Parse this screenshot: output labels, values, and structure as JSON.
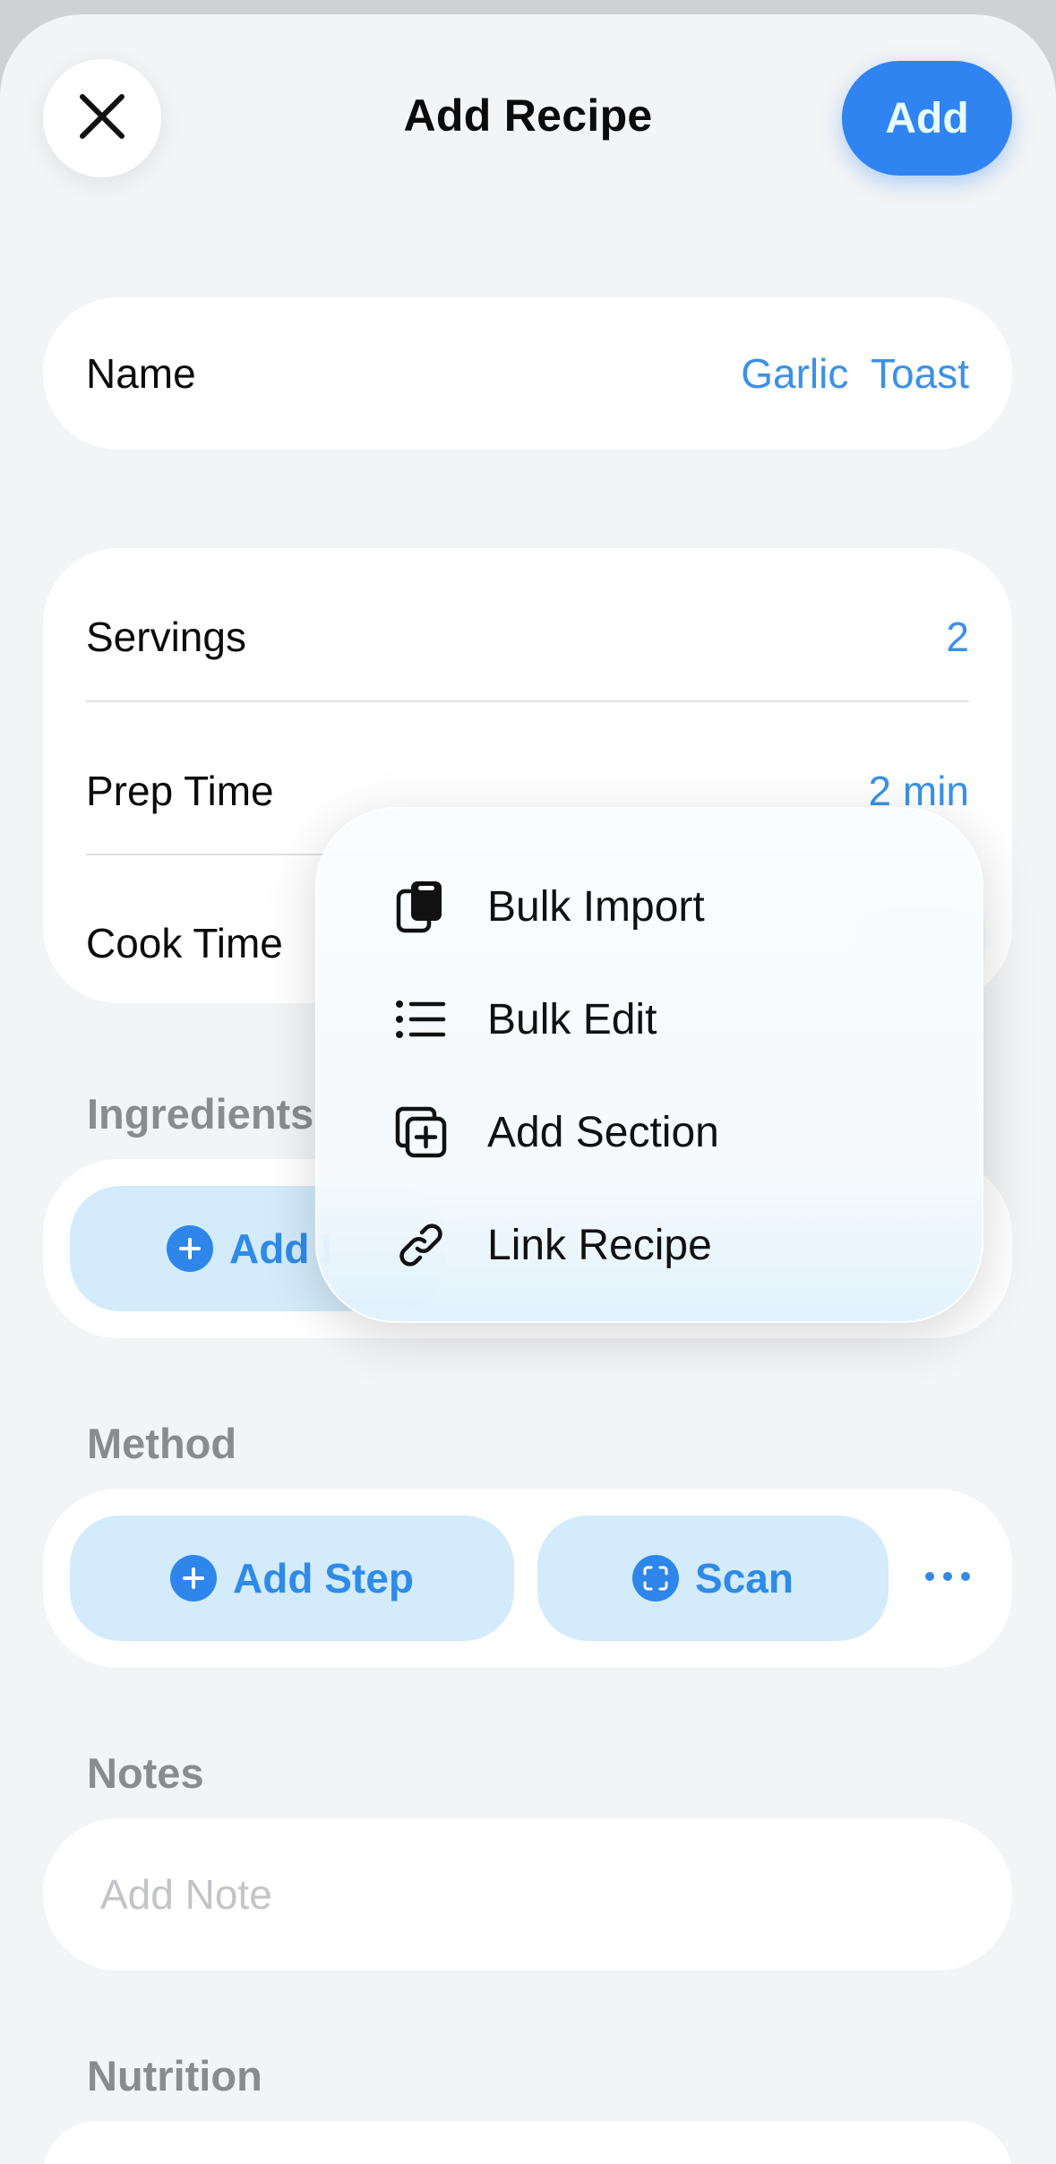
{
  "header": {
    "title": "Add Recipe",
    "close_icon": "close-icon",
    "add_label": "Add",
    "accent_color": "#2f84f2"
  },
  "name_row": {
    "label": "Name",
    "value": "Garlic  Toast"
  },
  "details": {
    "servings": {
      "label": "Servings",
      "value": "2"
    },
    "prep_time": {
      "label": "Prep Time",
      "value": "2 min"
    },
    "cook_time": {
      "label": "Cook Time"
    }
  },
  "ingredients": {
    "heading": "Ingredients",
    "add_button_label": "Add I"
  },
  "context_menu": {
    "items": [
      {
        "label": "Bulk Import",
        "icon": "bulk-import-icon"
      },
      {
        "label": "Bulk Edit",
        "icon": "list-icon"
      },
      {
        "label": "Add Section",
        "icon": "add-section-icon"
      },
      {
        "label": "Link Recipe",
        "icon": "link-icon"
      }
    ]
  },
  "method": {
    "heading": "Method",
    "add_step_label": "Add Step",
    "scan_label": "Scan",
    "more_icon": "ellipsis-icon"
  },
  "notes": {
    "heading": "Notes",
    "placeholder": "Add Note"
  },
  "nutrition": {
    "heading": "Nutrition"
  }
}
